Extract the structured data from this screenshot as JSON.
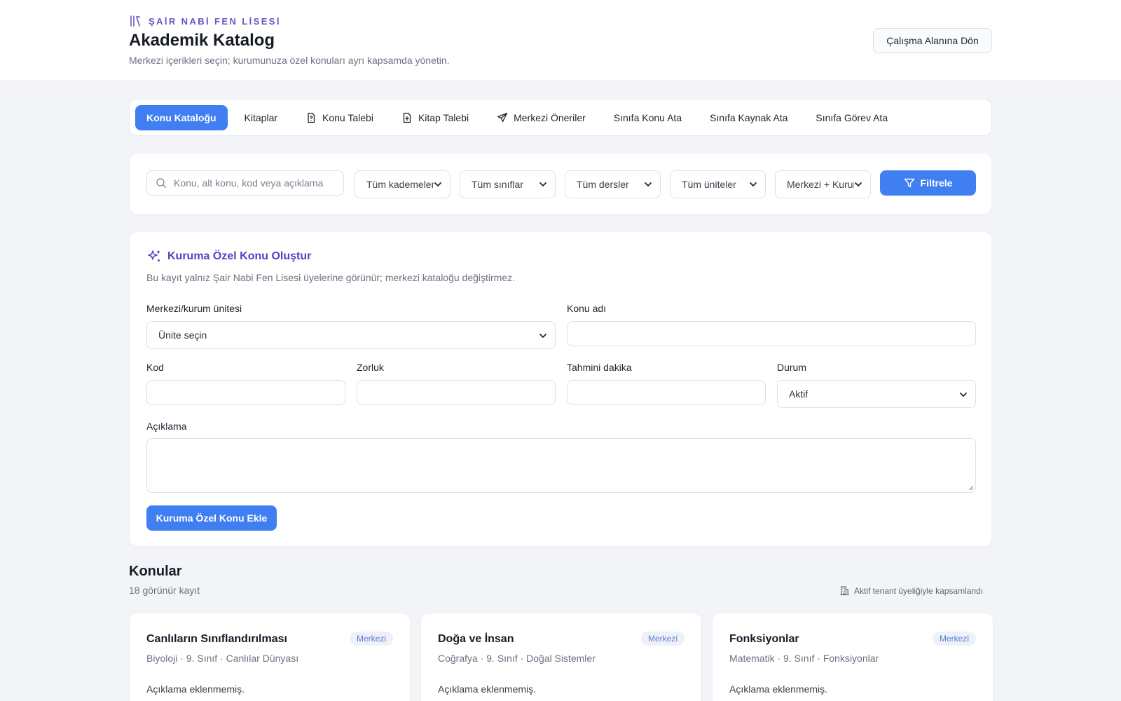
{
  "header": {
    "brand": "ŞAİR NABİ FEN LİSESİ",
    "title": "Akademik Katalog",
    "subtitle": "Merkezi içerikleri seçin; kurumunuza özel konuları ayrı kapsamda yönetin.",
    "back_button": "Çalışma Alanına Dön"
  },
  "tabs": [
    {
      "label": "Konu Kataloğu",
      "icon": "",
      "active": true
    },
    {
      "label": "Kitaplar",
      "icon": ""
    },
    {
      "label": "Konu Talebi",
      "icon": "file-question-icon"
    },
    {
      "label": "Kitap Talebi",
      "icon": "file-plus-icon"
    },
    {
      "label": "Merkezi Öneriler",
      "icon": "send-icon"
    },
    {
      "label": "Sınıfa Konu Ata",
      "icon": ""
    },
    {
      "label": "Sınıfa Kaynak Ata",
      "icon": ""
    },
    {
      "label": "Sınıfa Görev Ata",
      "icon": ""
    }
  ],
  "filters": {
    "search_placeholder": "Konu, alt konu, kod veya açıklama",
    "selects": [
      "Tüm kademeler",
      "Tüm sınıflar",
      "Tüm dersler",
      "Tüm üniteler",
      "Merkezi + Kurum"
    ],
    "button": "Filtrele"
  },
  "form": {
    "title": "Kuruma Özel Konu Oluştur",
    "description": "Bu kayıt yalnız Şair Nabi Fen Lisesi üyelerine görünür; merkezi kataloğu değiştirmez.",
    "unit_label": "Merkezi/kurum ünitesi",
    "unit_value": "Ünite seçin",
    "topic_label": "Konu adı",
    "code_label": "Kod",
    "difficulty_label": "Zorluk",
    "minutes_label": "Tahmini dakika",
    "status_label": "Durum",
    "status_value": "Aktif",
    "description_label": "Açıklama",
    "submit": "Kuruma Özel Konu Ekle"
  },
  "topics": {
    "title": "Konular",
    "count": "18 görünür kayıt",
    "scope_note": "Aktif tenant üyeliğiyle kapsamlandı",
    "items": [
      {
        "title": "Canlıların Sınıflandırılması",
        "badge": "Merkezi",
        "meta": "Biyoloji · 9. Sınıf · Canlılar Dünyası",
        "desc": "Açıklama eklenmemiş."
      },
      {
        "title": "Doğa ve İnsan",
        "badge": "Merkezi",
        "meta": "Coğrafya · 9. Sınıf · Doğal Sistemler",
        "desc": "Açıklama eklenmemiş."
      },
      {
        "title": "Fonksiyonlar",
        "badge": "Merkezi",
        "meta": "Matematik · 9. Sınıf · Fonksiyonlar",
        "desc": "Açıklama eklenmemiş."
      }
    ]
  },
  "colors": {
    "accent": "#3f7ff2",
    "brand": "#6b52c9",
    "badge_text": "#5a7ad9"
  }
}
